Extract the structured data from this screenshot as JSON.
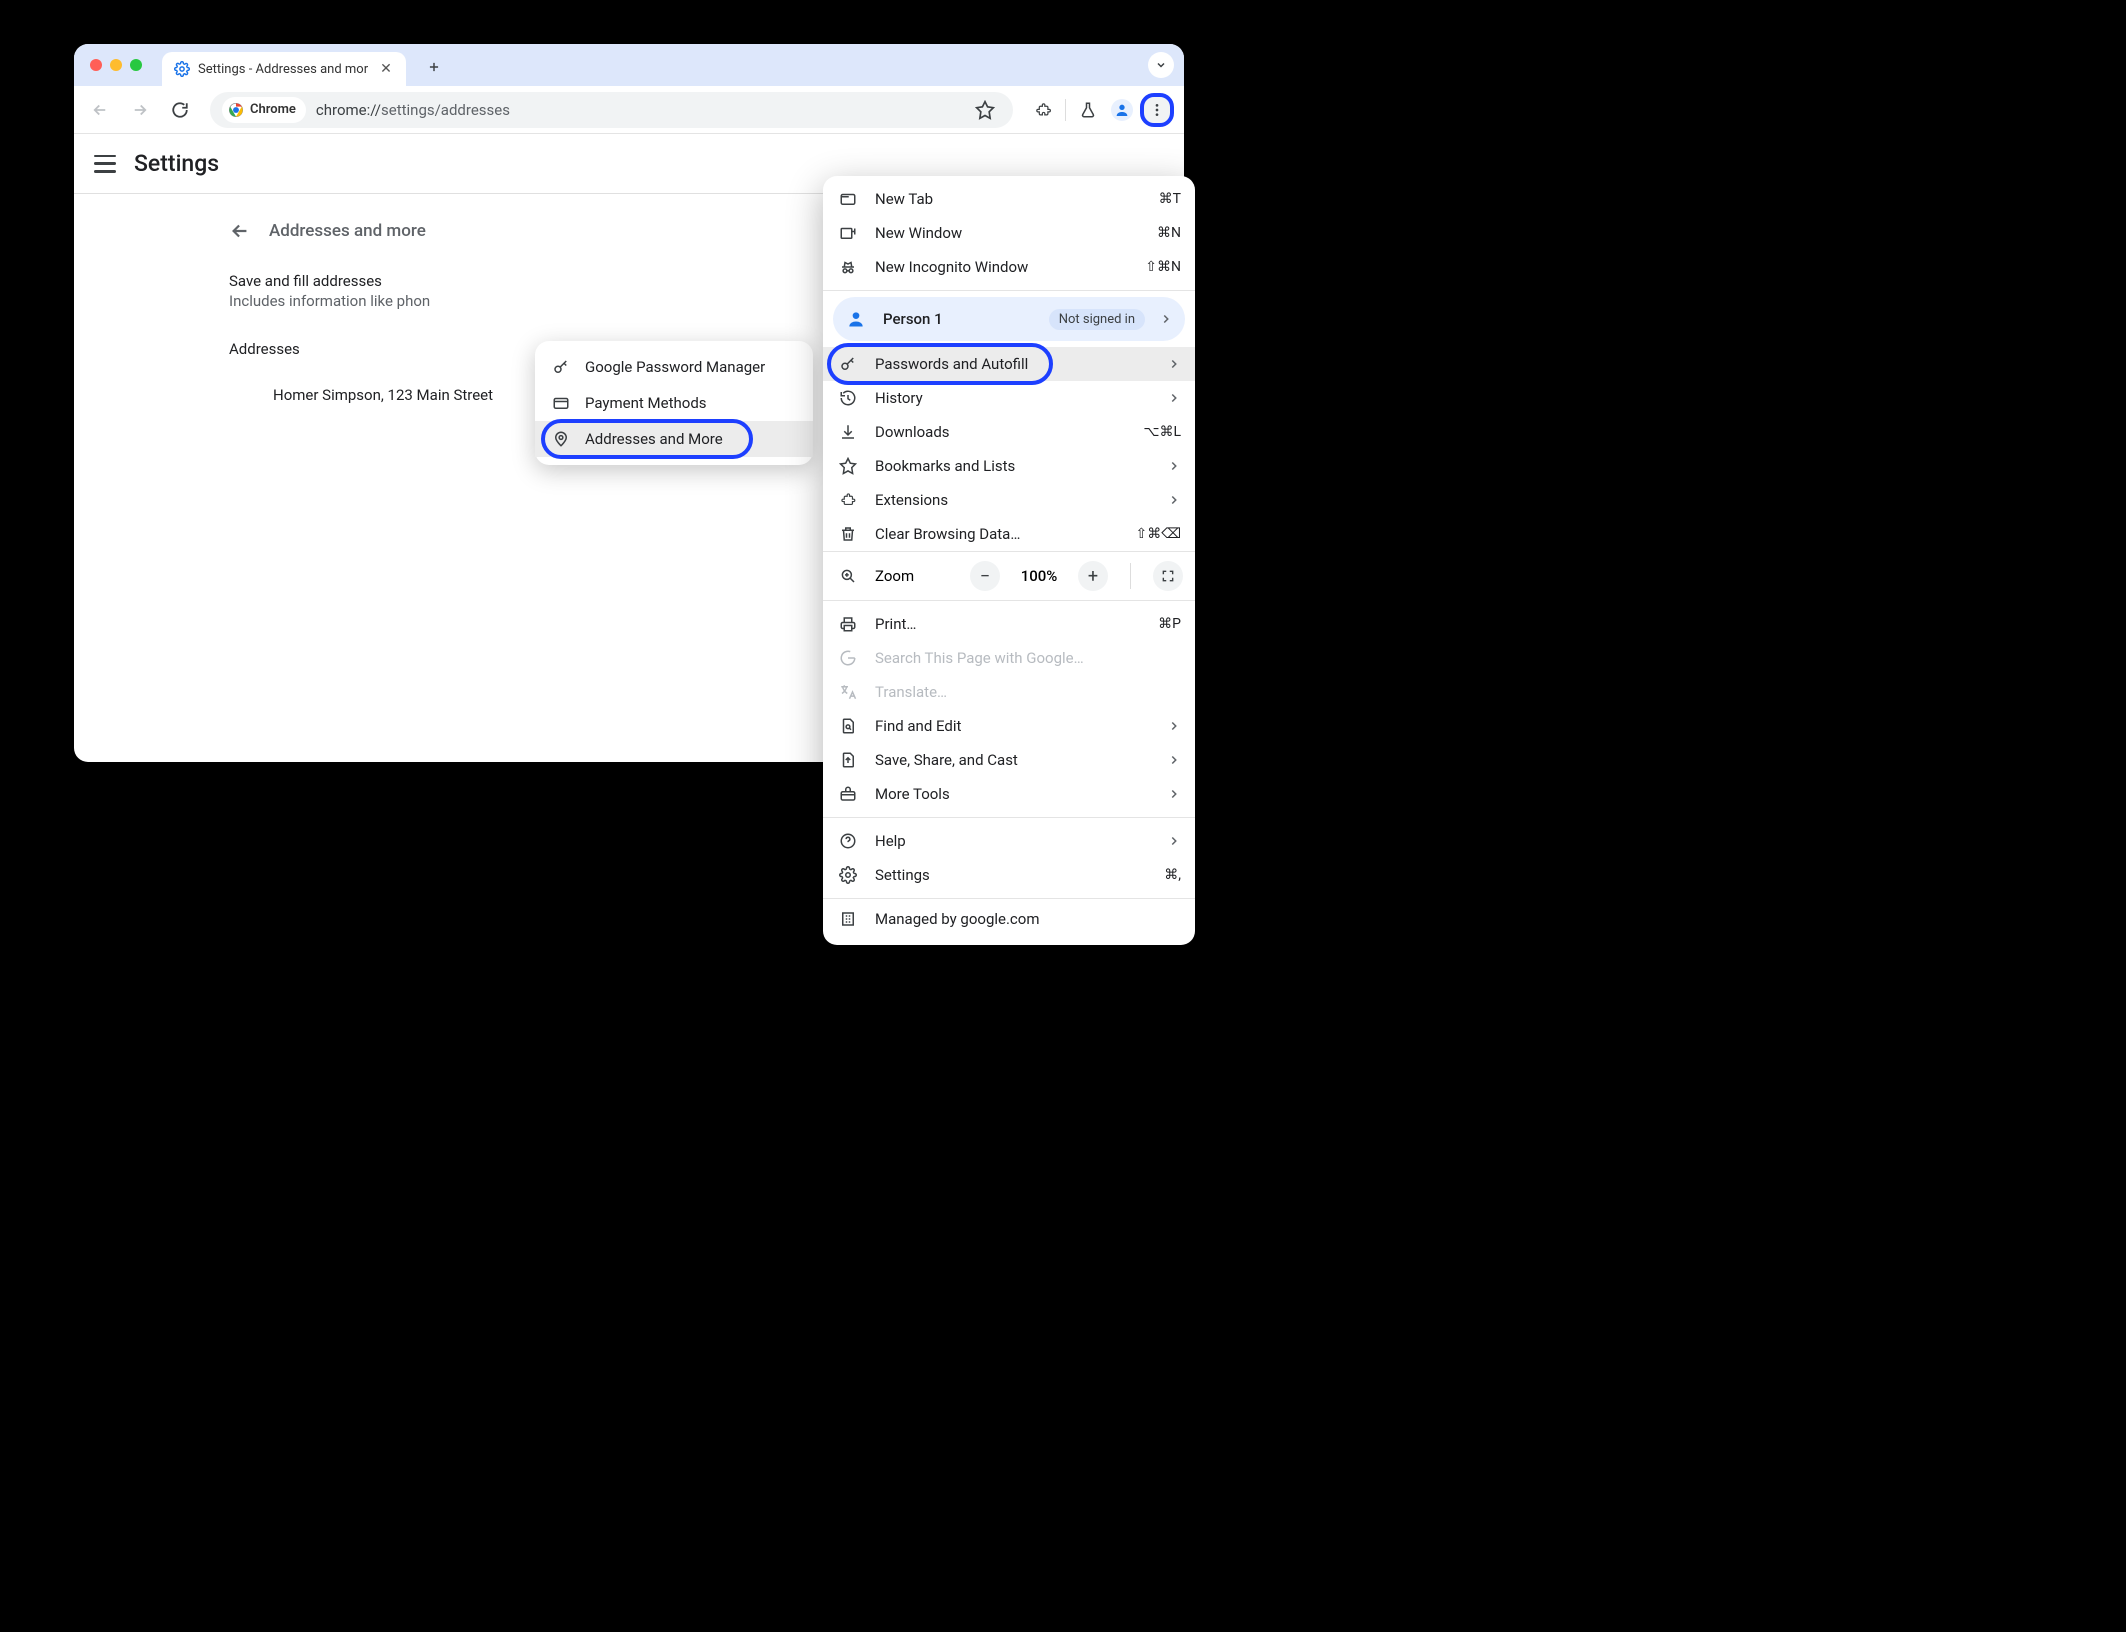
{
  "window": {
    "tab_title": "Settings - Addresses and mor",
    "new_tab_tooltip": "New tab"
  },
  "toolbar": {
    "chrome_chip": "Chrome",
    "url_scheme": "chrome://",
    "url_path": "settings/addresses"
  },
  "settings": {
    "app_title": "Settings",
    "section_title": "Addresses and more",
    "save_fill_title": "Save and fill addresses",
    "save_fill_sub": "Includes information like phon",
    "addresses_label": "Addresses",
    "address_entry": "Homer Simpson, 123 Main Street"
  },
  "submenu": {
    "items": [
      {
        "icon": "key",
        "label": "Google Password Manager"
      },
      {
        "icon": "card",
        "label": "Payment Methods"
      },
      {
        "icon": "pin",
        "label": "Addresses and More",
        "highlighted": true
      }
    ]
  },
  "menu": {
    "group_window": [
      {
        "icon": "tab",
        "label": "New Tab",
        "shortcut": "⌘T"
      },
      {
        "icon": "window-new",
        "label": "New Window",
        "shortcut": "⌘N"
      },
      {
        "icon": "incognito",
        "label": "New Incognito Window",
        "shortcut": "⇧⌘N"
      }
    ],
    "profile": {
      "name": "Person 1",
      "status": "Not signed in"
    },
    "passwords_autofill": {
      "icon": "key",
      "label": "Passwords and Autofill",
      "chev": true,
      "highlighted": true
    },
    "group_nav": [
      {
        "icon": "history",
        "label": "History",
        "chev": true
      },
      {
        "icon": "download",
        "label": "Downloads",
        "shortcut": "⌥⌘L"
      },
      {
        "icon": "star",
        "label": "Bookmarks and Lists",
        "chev": true
      },
      {
        "icon": "puzzle",
        "label": "Extensions",
        "chev": true
      },
      {
        "icon": "trash",
        "label": "Clear Browsing Data…",
        "shortcut": "⇧⌘⌫"
      }
    ],
    "zoom": {
      "label": "Zoom",
      "value": "100%"
    },
    "group_page": [
      {
        "icon": "print",
        "label": "Print…",
        "shortcut": "⌘P"
      },
      {
        "icon": "google",
        "label": "Search This Page with Google…",
        "disabled": true
      },
      {
        "icon": "translate",
        "label": "Translate…",
        "disabled": true
      },
      {
        "icon": "find",
        "label": "Find and Edit",
        "chev": true
      },
      {
        "icon": "share",
        "label": "Save, Share, and Cast",
        "chev": true
      },
      {
        "icon": "toolbox",
        "label": "More Tools",
        "chev": true
      }
    ],
    "group_help": [
      {
        "icon": "help",
        "label": "Help",
        "chev": true
      },
      {
        "icon": "gear",
        "label": "Settings",
        "shortcut": "⌘,"
      }
    ],
    "managed": {
      "icon": "building",
      "label": "Managed by google.com"
    }
  }
}
